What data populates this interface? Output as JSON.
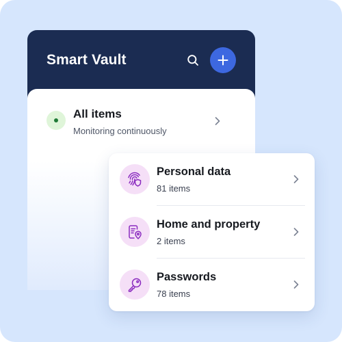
{
  "app": {
    "title": "Smart Vault"
  },
  "header": {
    "search_icon": "search-icon",
    "add_icon": "plus-icon"
  },
  "all_items": {
    "title": "All items",
    "subtitle": "Monitoring continuously",
    "status_color": "#1e7a36"
  },
  "categories": [
    {
      "title": "Personal data",
      "count": "81 items",
      "icon": "fingerprint-shield-icon"
    },
    {
      "title": "Home and property",
      "count": "2 items",
      "icon": "document-pin-icon"
    },
    {
      "title": "Passwords",
      "count": "78 items",
      "icon": "key-icon"
    }
  ],
  "colors": {
    "header_bg": "#1b2c52",
    "accent": "#3d68e0",
    "icon_bg": "#f5dff7",
    "icon_fg": "#8a2bbf",
    "background": "#d6e6fd"
  }
}
